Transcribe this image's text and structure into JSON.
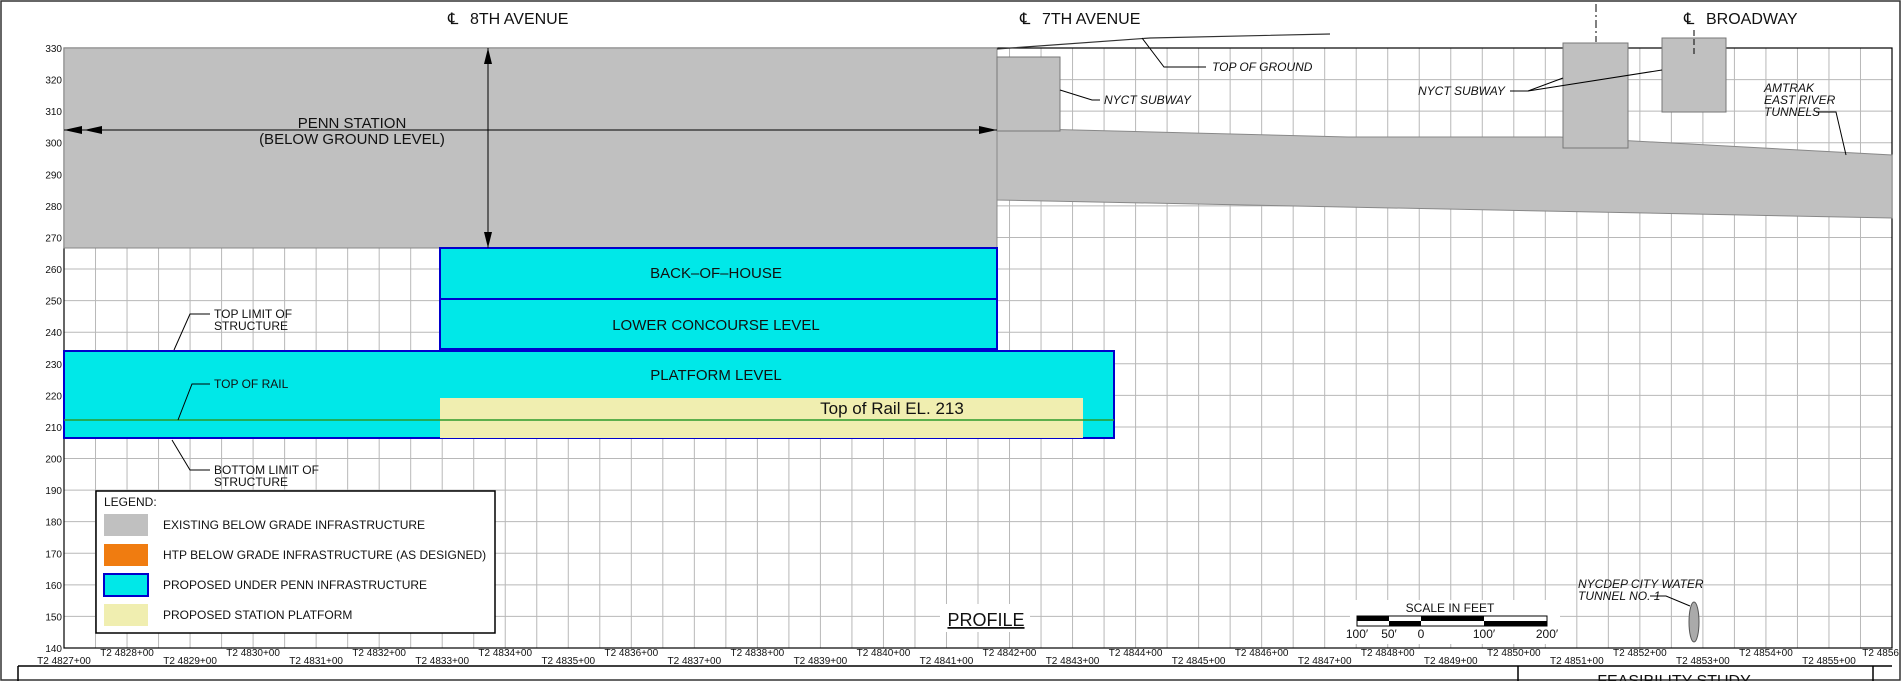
{
  "drawing": {
    "centerlines": [
      "8TH  AVENUE",
      "7TH  AVENUE",
      "BROADWAY"
    ],
    "centerline_symbol": "℄",
    "elevation_ticks": [
      330,
      320,
      310,
      300,
      290,
      280,
      270,
      260,
      250,
      240,
      230,
      220,
      210,
      200,
      190,
      180,
      170,
      160,
      150,
      140
    ],
    "station_ticks": [
      "T2 4827+00",
      "T2 4828+00",
      "T2 4829+00",
      "T2 4830+00",
      "T2 4831+00",
      "T2 4832+00",
      "T2 4833+00",
      "T2 4834+00",
      "T2 4835+00",
      "T2 4836+00",
      "T2 4837+00",
      "T2 4838+00",
      "T2 4839+00",
      "T2 4840+00",
      "T2 4841+00",
      "T2 4842+00",
      "T2 4843+00",
      "T2 4844+00",
      "T2 4845+00",
      "T2 4846+00",
      "T2 4847+00",
      "T2 4848+00",
      "T2 4849+00",
      "T2 4850+00",
      "T2 4851+00",
      "T2 4852+00",
      "T2 4853+00",
      "T2 4854+00",
      "T2 4855+00",
      "T2 4856"
    ],
    "penn_station": [
      "PENN  STATION",
      "(BELOW  GROUND  LEVEL)"
    ],
    "levels": {
      "back_of_house": "BACK–OF–HOUSE",
      "lower_concourse": "LOWER  CONCOURSE  LEVEL",
      "platform": "PLATFORM  LEVEL",
      "top_of_rail": "Top of Rail EL. 213"
    },
    "annotations": {
      "top_limit": [
        "TOP  LIMIT  OF",
        "STRUCTURE"
      ],
      "top_of_rail": "TOP  OF  RAIL",
      "bottom_limit": [
        "BOTTOM  LIMIT  OF",
        "STRUCTURE"
      ],
      "top_of_ground": "TOP  OF  GROUND",
      "nyct_subway_1": "NYCT  SUBWAY",
      "nyct_subway_2": "NYCT  SUBWAY",
      "amtrak": [
        "AMTRAK",
        "EAST  RIVER",
        "TUNNELS"
      ],
      "nycdep": [
        "NYCDEP  CITY  WATER",
        "TUNNEL  NO. 1"
      ]
    },
    "legend": {
      "title": "LEGEND:",
      "items": [
        {
          "label": "EXISTING  BELOW  GRADE  INFRASTRUCTURE",
          "color": "#c0c0c0"
        },
        {
          "label": "HTP  BELOW  GRADE  INFRASTRUCTURE  (AS  DESIGNED)",
          "color": "#f07c10"
        },
        {
          "label": "PROPOSED  UNDER  PENN  INFRASTRUCTURE",
          "color": "#00e8e8"
        },
        {
          "label": "PROPOSED  STATION  PLATFORM",
          "color": "#f0eeb0"
        }
      ]
    },
    "profile_title": "PROFILE",
    "scale": {
      "title": "SCALE  IN  FEET",
      "labels": [
        "100′",
        "50′",
        "0",
        "100′",
        "200′"
      ]
    },
    "title_block": "FEASIBILITY  STUDY",
    "colors": {
      "existing": "#c0c0c0",
      "proposed": "#00e8e8",
      "proposed_outline": "#0000cc",
      "platform": "#f0eeb0",
      "rail_line": "#2a9a2a",
      "grid": "#b8b8b8"
    }
  }
}
